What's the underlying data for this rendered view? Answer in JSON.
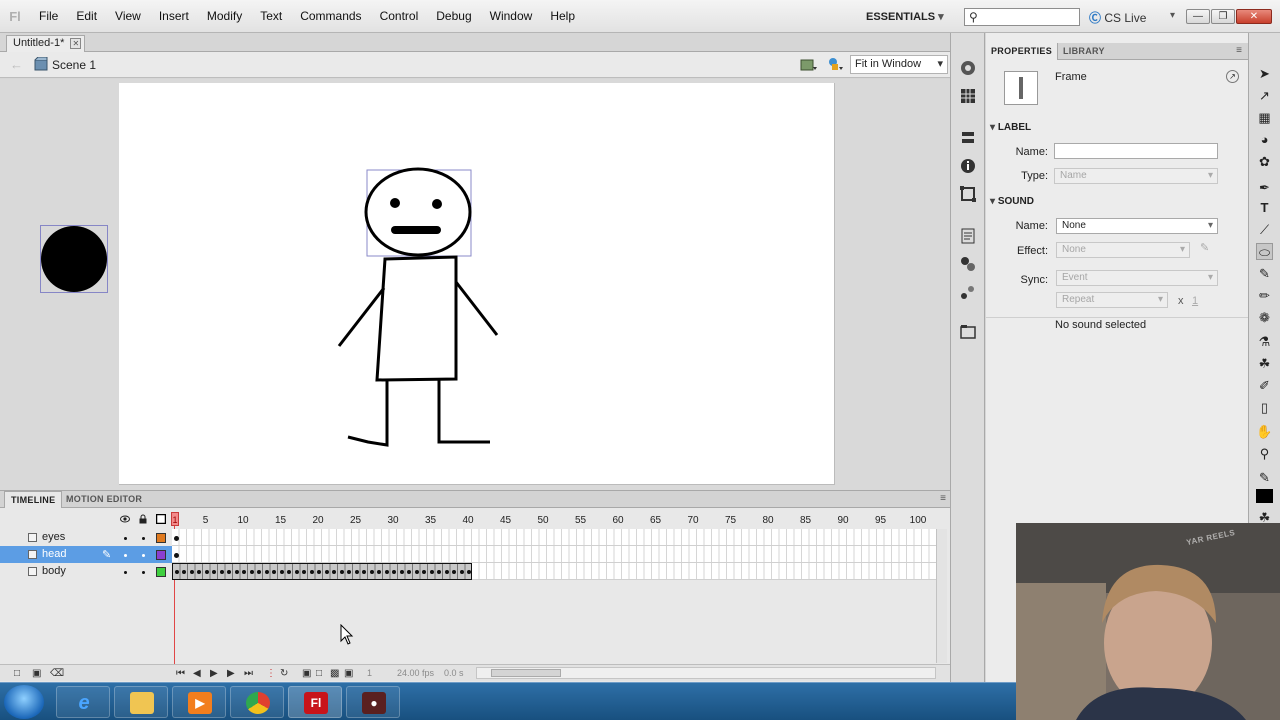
{
  "menu": {
    "logo": "Fl",
    "items": [
      "File",
      "Edit",
      "View",
      "Insert",
      "Modify",
      "Text",
      "Commands",
      "Control",
      "Debug",
      "Window",
      "Help"
    ],
    "workspace": "ESSENTIALS",
    "search_placeholder": "",
    "cs_live": "CS Live"
  },
  "document": {
    "tab_title": "Untitled-1*",
    "scene": "Scene 1",
    "zoom": "Fit in Window"
  },
  "timeline": {
    "tabs": [
      "TIMELINE",
      "MOTION EDITOR"
    ],
    "ruler_numbers": [
      "5",
      "10",
      "15",
      "20",
      "25",
      "30",
      "35",
      "40",
      "45",
      "50",
      "55",
      "60",
      "65",
      "70",
      "75",
      "80",
      "85",
      "90",
      "95",
      "100"
    ],
    "current_frame_marker": "1",
    "layers": [
      {
        "name": "eyes",
        "color": "#e07a1f",
        "selected": false
      },
      {
        "name": "head",
        "color": "#8a3fd0",
        "selected": true
      },
      {
        "name": "body",
        "color": "#3fcf3f",
        "selected": false
      }
    ],
    "body_frames": 40,
    "status": {
      "frame": "1",
      "fps": "24.00 fps",
      "time": "0.0 s"
    }
  },
  "properties": {
    "tabs": [
      "PROPERTIES",
      "LIBRARY"
    ],
    "object_type": "Frame",
    "label_section": "LABEL",
    "label_name_label": "Name:",
    "label_name_value": "",
    "label_type_label": "Type:",
    "label_type_value": "Name",
    "sound_section": "SOUND",
    "sound_name_label": "Name:",
    "sound_name_value": "None",
    "effect_label": "Effect:",
    "effect_value": "None",
    "sync_label": "Sync:",
    "sync_value": "Event",
    "repeat_value": "Repeat",
    "repeat_times_prefix": "x",
    "repeat_times": "1",
    "no_sound": "No sound selected"
  },
  "taskbar": {
    "apps": [
      "Internet Explorer",
      "Windows Explorer",
      "Media Player",
      "Google Chrome",
      "Adobe Flash",
      "Recorder"
    ],
    "active_app": "Adobe Flash"
  },
  "webcam": {
    "watermark": "YAR REELS"
  },
  "colors": {
    "accent_selection": "#5c9de4",
    "stage": "#ffffff",
    "pasteboard": "#d9d9d9",
    "playhead": "#e04646"
  }
}
